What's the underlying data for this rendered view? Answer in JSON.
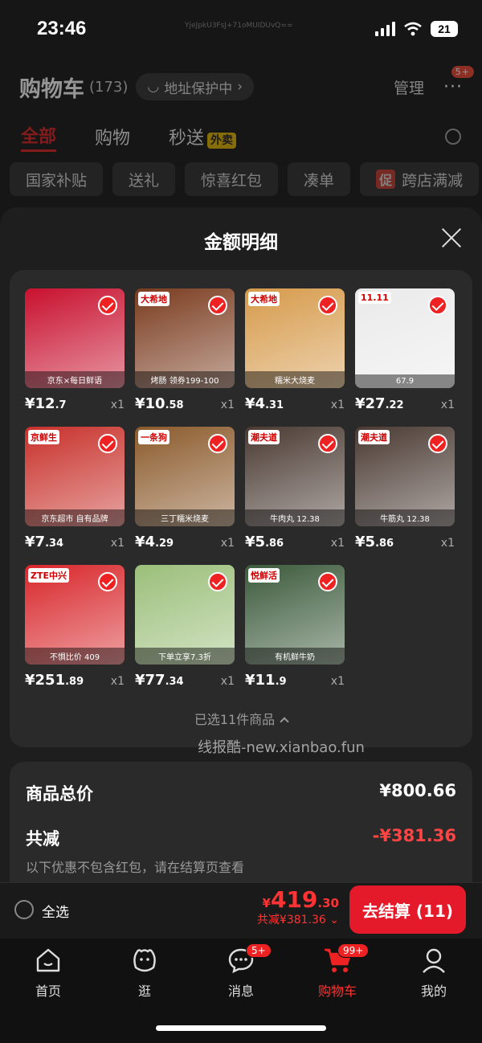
{
  "status": {
    "time": "23:46",
    "watermark": "YjeJpkU3FsJ+71oMUIDUvQ==",
    "battery": "21"
  },
  "header": {
    "title": "购物车",
    "count": "(173)",
    "address": "地址保护中",
    "manage": "管理",
    "more": "···",
    "more_badge": "5+"
  },
  "tabs": [
    {
      "label": "全部"
    },
    {
      "label": "购物"
    },
    {
      "label": "秒送"
    }
  ],
  "tab_badge": "外卖",
  "chips": [
    "国家补贴",
    "送礼",
    "惊喜红包",
    "凑单"
  ],
  "chip_promo": {
    "tag": "促",
    "label": "跨店满减"
  },
  "sheet": {
    "title": "金额明细"
  },
  "items": [
    {
      "int": "¥12",
      "dec": ".7",
      "qty": "x1",
      "tag": "",
      "label": "京东×每日鲜语",
      "color": "#c8102e"
    },
    {
      "int": "¥10",
      "dec": ".58",
      "qty": "x1",
      "tag": "大希地",
      "label": "烤肠 领券199-100",
      "color": "#7a3b1e"
    },
    {
      "int": "¥4",
      "dec": ".31",
      "qty": "x1",
      "tag": "大希地",
      "label": "糯米大烧麦",
      "color": "#d69a4a"
    },
    {
      "int": "¥27",
      "dec": ".22",
      "qty": "x1",
      "tag": "11.11",
      "label": "67.9",
      "color": "#eaeaea"
    },
    {
      "int": "¥7",
      "dec": ".34",
      "qty": "x1",
      "tag": "京鲜生",
      "label": "京东超市 自有品牌",
      "color": "#c8302a"
    },
    {
      "int": "¥4",
      "dec": ".29",
      "qty": "x1",
      "tag": "一条狗",
      "label": "三丁糯米烧麦",
      "color": "#8b5a2b"
    },
    {
      "int": "¥5",
      "dec": ".86",
      "qty": "x1",
      "tag": "潮夫道",
      "label": "牛肉丸 12.38",
      "color": "#4a3a32"
    },
    {
      "int": "¥5",
      "dec": ".86",
      "qty": "x1",
      "tag": "潮夫道",
      "label": "牛筋丸 12.38",
      "color": "#4a3a32"
    },
    {
      "int": "¥251",
      "dec": ".89",
      "qty": "x1",
      "tag": "ZTE中兴",
      "label": "不惧比价 409",
      "color": "#d8262a"
    },
    {
      "int": "¥77",
      "dec": ".34",
      "qty": "x1",
      "tag": "",
      "label": "下单立享7.3折",
      "color": "#9bbf7a"
    },
    {
      "int": "¥11",
      "dec": ".9",
      "qty": "x1",
      "tag": "悦鲜活",
      "label": "有机鲜牛奶",
      "color": "#3b5a3b"
    }
  ],
  "selected": "已选11件商品",
  "watermark2": "线报酷-new.xianbao.fun",
  "summary": {
    "total_label": "商品总价",
    "total_value": "¥800.66",
    "reduce_label": "共减",
    "reduce_value": "-¥381.36",
    "note": "以下优惠不包含红包，请在结算页查看"
  },
  "checkout": {
    "select_all": "全选",
    "price_sym": "¥",
    "price_int": "419",
    "price_dec": ".30",
    "reduce": "共减¥381.36",
    "button": "去结算 (11)"
  },
  "nav": [
    {
      "label": "首页",
      "badge": ""
    },
    {
      "label": "逛",
      "badge": ""
    },
    {
      "label": "消息",
      "badge": "5+"
    },
    {
      "label": "购物车",
      "badge": "99+"
    },
    {
      "label": "我的",
      "badge": ""
    }
  ]
}
